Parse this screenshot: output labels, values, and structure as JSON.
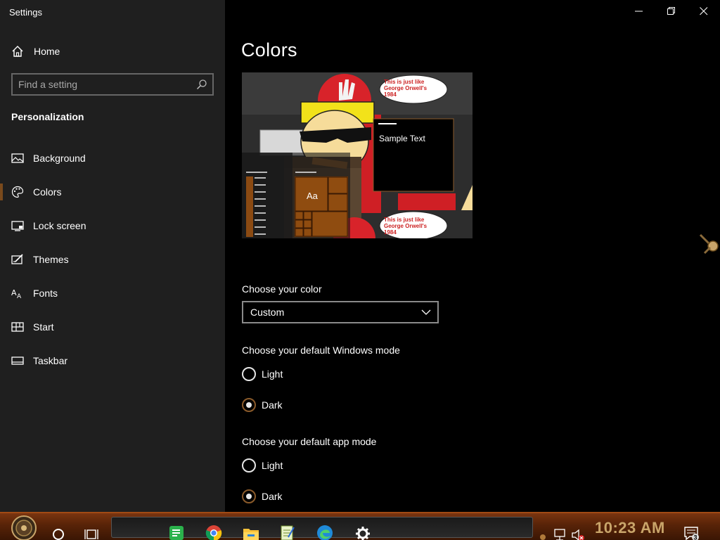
{
  "window": {
    "title": "Settings",
    "controls": {
      "minimize": "minimize-icon",
      "maximize": "restore-icon",
      "close": "close-icon"
    }
  },
  "sidebar": {
    "home_label": "Home",
    "search": {
      "placeholder": "Find a setting",
      "value": ""
    },
    "section_title": "Personalization",
    "items": [
      {
        "label": "Background",
        "icon": "image-icon",
        "active": false
      },
      {
        "label": "Colors",
        "icon": "palette-icon",
        "active": true
      },
      {
        "label": "Lock screen",
        "icon": "lock-screen-icon",
        "active": false
      },
      {
        "label": "Themes",
        "icon": "themes-icon",
        "active": false
      },
      {
        "label": "Fonts",
        "icon": "fonts-icon",
        "active": false
      },
      {
        "label": "Start",
        "icon": "start-icon",
        "active": false
      },
      {
        "label": "Taskbar",
        "icon": "taskbar-icon",
        "active": false
      }
    ]
  },
  "main": {
    "title": "Colors",
    "preview": {
      "sample_text": "Sample Text",
      "tile_text": "Aa",
      "bubble_text": "This is just like George Orwell's 1984"
    },
    "choose_color": {
      "label": "Choose your color",
      "selected": "Custom"
    },
    "windows_mode": {
      "label": "Choose your default Windows mode",
      "options": [
        "Light",
        "Dark"
      ],
      "selected": "Dark"
    },
    "app_mode": {
      "label": "Choose your default app mode",
      "options": [
        "Light",
        "Dark"
      ],
      "selected": "Dark"
    }
  },
  "taskbar": {
    "apps": [
      "start-orb-icon",
      "cortana-icon",
      "task-view-icon",
      "notes-app-icon",
      "chrome-icon",
      "file-explorer-icon",
      "notepad-icon",
      "edge-icon",
      "settings-gear-icon"
    ],
    "clock": "10:23 AM",
    "notification_count": "3"
  },
  "colors": {
    "accent": "#8a5a2a",
    "sidebar_bg": "#1f1f1f",
    "content_bg": "#000000",
    "taskbar_bg": "#5a2408",
    "clock": "#c9a56a"
  }
}
